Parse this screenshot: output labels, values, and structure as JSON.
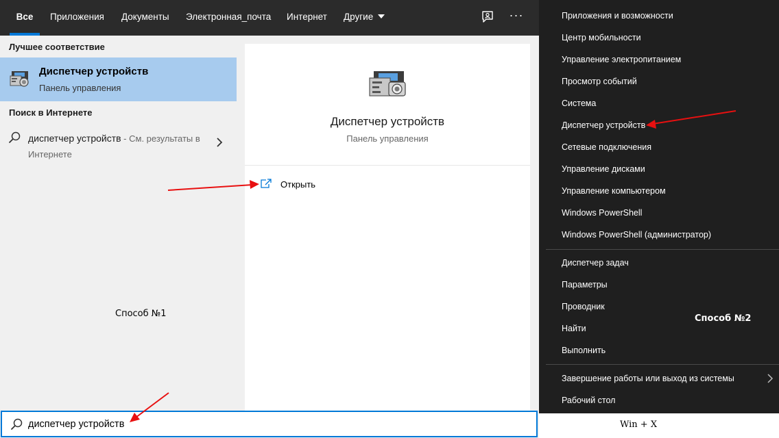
{
  "tabs": {
    "all": "Все",
    "apps": "Приложения",
    "documents": "Документы",
    "email": "Электронная_почта",
    "web": "Интернет",
    "more": "Другие",
    "more_options": "···"
  },
  "left": {
    "best_match_header": "Лучшее соответствие",
    "best_match": {
      "title": "Диспетчер устройств",
      "subtitle": "Панель управления"
    },
    "web_search_header": "Поиск в Интернете",
    "web_result": {
      "query": "диспетчер устройств",
      "hint": " - См. результаты в Интернете"
    }
  },
  "preview": {
    "title": "Диспетчер устройств",
    "subtitle": "Панель управления",
    "open_label": "Открыть"
  },
  "search": {
    "value": "диспетчер устройств"
  },
  "annotations": {
    "method1": "Способ №1",
    "method2": "Способ №2",
    "winx_caption": "Win + X"
  },
  "winx_menu": {
    "items": [
      "Приложения и возможности",
      "Центр мобильности",
      "Управление электропитанием",
      "Просмотр событий",
      "Система",
      "Диспетчер устройств",
      "Сетевые подключения",
      "Управление дисками",
      "Управление компьютером",
      "Windows PowerShell",
      "Windows PowerShell (администратор)",
      "Диспетчер задач",
      "Параметры",
      "Проводник",
      "Найти",
      "Выполнить",
      "Завершение работы или выход из системы",
      "Рабочий стол"
    ]
  },
  "colors": {
    "accent": "#0078d7",
    "selected_item": "#a7cbee",
    "tab_bar": "#2b2b2b",
    "menu_bg": "#1f1f1f",
    "arrow": "#e81010"
  },
  "icons": [
    "feedback-icon",
    "more-options-icon",
    "device-manager-icon",
    "search-icon",
    "chevron-right-icon",
    "open-external-icon",
    "submenu-chevron-icon"
  ]
}
